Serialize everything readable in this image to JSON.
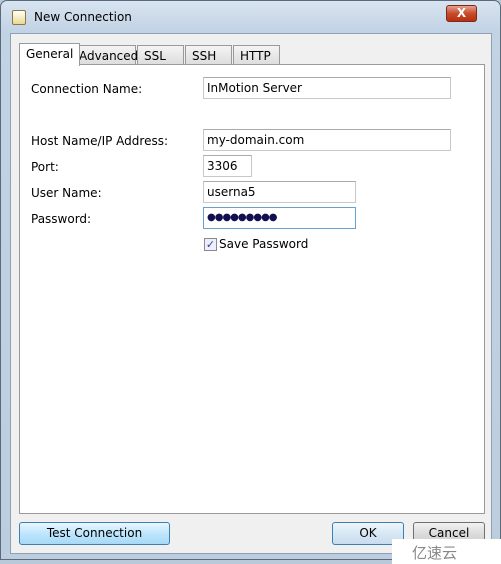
{
  "window": {
    "title": "New Connection",
    "close_label": "X"
  },
  "tabs": [
    {
      "label": "General",
      "active": true
    },
    {
      "label": "Advanced"
    },
    {
      "label": "SSL"
    },
    {
      "label": "SSH"
    },
    {
      "label": "HTTP"
    }
  ],
  "form": {
    "connection_name": {
      "label": "Connection Name:",
      "value": "InMotion Server"
    },
    "host": {
      "label": "Host Name/IP Address:",
      "value": "my-domain.com"
    },
    "port": {
      "label": "Port:",
      "value": "3306"
    },
    "user": {
      "label": "User Name:",
      "value": "userna5"
    },
    "password": {
      "label": "Password:",
      "value": "●●●●●●●●●"
    },
    "save_password": {
      "label": "Save Password",
      "checked": true,
      "check": "✓"
    }
  },
  "buttons": {
    "test": "Test Connection",
    "ok": "OK",
    "cancel": "Cancel"
  },
  "watermark": "亿速云"
}
